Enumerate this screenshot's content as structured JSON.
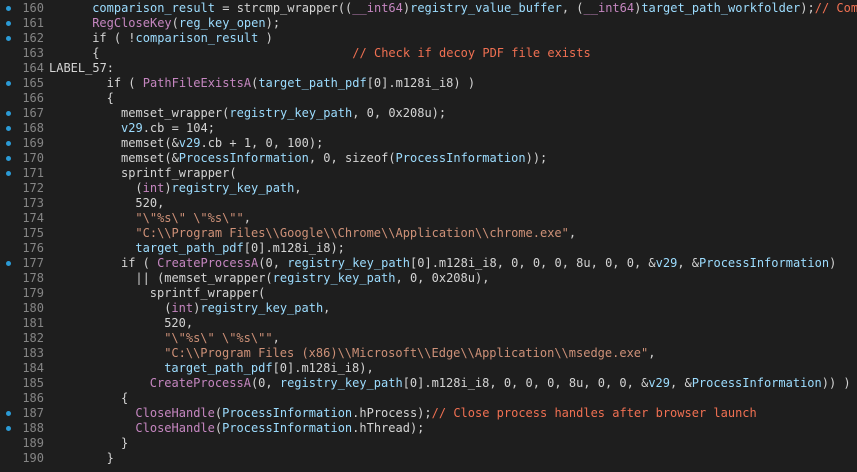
{
  "colors": {
    "background": "#1e1e1e",
    "line_number": "#858585",
    "breakpoint_dot": "#2b9bd6",
    "plain": "#d4d4d4",
    "variable": "#9cdcfe",
    "function": "#c586c0",
    "string": "#ce9178",
    "comment": "#f07052"
  },
  "lines": [
    {
      "num": "160",
      "dot": true,
      "indent": 6,
      "tokens": [
        {
          "t": "var",
          "s": "comparison_result"
        },
        {
          "t": "plain",
          "s": " = strcmp_wrapper(("
        },
        {
          "t": "type",
          "s": "__int64"
        },
        {
          "t": "plain",
          "s": ")"
        },
        {
          "t": "var",
          "s": "registry_value_buffer"
        },
        {
          "t": "plain",
          "s": ", ("
        },
        {
          "t": "type",
          "s": "__int64"
        },
        {
          "t": "plain",
          "s": ")"
        },
        {
          "t": "var",
          "s": "target_path_workfolder"
        },
        {
          "t": "plain",
          "s": ");"
        },
        {
          "t": "comment",
          "s": "// Compa"
        }
      ]
    },
    {
      "num": "161",
      "dot": true,
      "indent": 6,
      "tokens": [
        {
          "t": "fn",
          "s": "RegCloseKey"
        },
        {
          "t": "plain",
          "s": "("
        },
        {
          "t": "var",
          "s": "reg_key_open"
        },
        {
          "t": "plain",
          "s": ");"
        }
      ]
    },
    {
      "num": "162",
      "dot": true,
      "indent": 6,
      "tokens": [
        {
          "t": "plain",
          "s": "if ( !"
        },
        {
          "t": "var",
          "s": "comparison_result"
        },
        {
          "t": "plain",
          "s": " )"
        }
      ]
    },
    {
      "num": "163",
      "dot": false,
      "indent": 6,
      "tokens": [
        {
          "t": "plain",
          "s": "{"
        },
        {
          "t": "plain",
          "s": "                                   "
        },
        {
          "t": "comment",
          "s": "// Check if decoy PDF file exists"
        }
      ]
    },
    {
      "num": "164",
      "dot": false,
      "indent": 0,
      "tokens": [
        {
          "t": "plain",
          "s": "LABEL_57:"
        }
      ]
    },
    {
      "num": "165",
      "dot": true,
      "indent": 8,
      "tokens": [
        {
          "t": "plain",
          "s": "if ( "
        },
        {
          "t": "fn",
          "s": "PathFileExistsA"
        },
        {
          "t": "plain",
          "s": "("
        },
        {
          "t": "var",
          "s": "target_path_pdf"
        },
        {
          "t": "plain",
          "s": "[0].m128i_i8) )"
        }
      ]
    },
    {
      "num": "166",
      "dot": false,
      "indent": 8,
      "tokens": [
        {
          "t": "plain",
          "s": "{"
        }
      ]
    },
    {
      "num": "167",
      "dot": true,
      "indent": 10,
      "tokens": [
        {
          "t": "plain",
          "s": "memset_wrapper("
        },
        {
          "t": "var",
          "s": "registry_key_path"
        },
        {
          "t": "plain",
          "s": ", 0, 0x208u);"
        }
      ]
    },
    {
      "num": "168",
      "dot": true,
      "indent": 10,
      "tokens": [
        {
          "t": "var",
          "s": "v29"
        },
        {
          "t": "plain",
          "s": ".cb = 104;"
        }
      ]
    },
    {
      "num": "169",
      "dot": true,
      "indent": 10,
      "tokens": [
        {
          "t": "plain",
          "s": "memset(&"
        },
        {
          "t": "var",
          "s": "v29"
        },
        {
          "t": "plain",
          "s": ".cb + 1, 0, 100);"
        }
      ]
    },
    {
      "num": "170",
      "dot": true,
      "indent": 10,
      "tokens": [
        {
          "t": "plain",
          "s": "memset(&"
        },
        {
          "t": "var",
          "s": "ProcessInformation"
        },
        {
          "t": "plain",
          "s": ", 0, sizeof("
        },
        {
          "t": "var",
          "s": "ProcessInformation"
        },
        {
          "t": "plain",
          "s": "));"
        }
      ]
    },
    {
      "num": "171",
      "dot": true,
      "indent": 10,
      "tokens": [
        {
          "t": "plain",
          "s": "sprintf_wrapper("
        }
      ]
    },
    {
      "num": "172",
      "dot": false,
      "indent": 12,
      "tokens": [
        {
          "t": "plain",
          "s": "("
        },
        {
          "t": "type",
          "s": "int"
        },
        {
          "t": "plain",
          "s": ")"
        },
        {
          "t": "var",
          "s": "registry_key_path"
        },
        {
          "t": "plain",
          "s": ","
        }
      ]
    },
    {
      "num": "173",
      "dot": false,
      "indent": 12,
      "tokens": [
        {
          "t": "plain",
          "s": "520,"
        }
      ]
    },
    {
      "num": "174",
      "dot": false,
      "indent": 12,
      "tokens": [
        {
          "t": "str",
          "s": "\"\\\"%s\\\" \\\"%s\\\"\""
        },
        {
          "t": "plain",
          "s": ","
        }
      ]
    },
    {
      "num": "175",
      "dot": false,
      "indent": 12,
      "tokens": [
        {
          "t": "str",
          "s": "\"C:\\\\Program Files\\\\Google\\\\Chrome\\\\Application\\\\chrome.exe\""
        },
        {
          "t": "plain",
          "s": ","
        }
      ]
    },
    {
      "num": "176",
      "dot": false,
      "indent": 12,
      "tokens": [
        {
          "t": "var",
          "s": "target_path_pdf"
        },
        {
          "t": "plain",
          "s": "[0].m128i_i8);"
        }
      ]
    },
    {
      "num": "177",
      "dot": true,
      "indent": 10,
      "tokens": [
        {
          "t": "plain",
          "s": "if ( "
        },
        {
          "t": "fn",
          "s": "CreateProcessA"
        },
        {
          "t": "plain",
          "s": "(0, "
        },
        {
          "t": "var",
          "s": "registry_key_path"
        },
        {
          "t": "plain",
          "s": "[0].m128i_i8, 0, 0, 0, 8u, 0, 0, &"
        },
        {
          "t": "var",
          "s": "v29"
        },
        {
          "t": "plain",
          "s": ", &"
        },
        {
          "t": "var",
          "s": "ProcessInformation"
        },
        {
          "t": "plain",
          "s": ")"
        }
      ]
    },
    {
      "num": "178",
      "dot": false,
      "indent": 12,
      "tokens": [
        {
          "t": "plain",
          "s": "|| (memset_wrapper("
        },
        {
          "t": "var",
          "s": "registry_key_path"
        },
        {
          "t": "plain",
          "s": ", 0, 0x208u),"
        }
      ]
    },
    {
      "num": "179",
      "dot": false,
      "indent": 14,
      "tokens": [
        {
          "t": "plain",
          "s": "sprintf_wrapper("
        }
      ]
    },
    {
      "num": "180",
      "dot": false,
      "indent": 16,
      "tokens": [
        {
          "t": "plain",
          "s": "("
        },
        {
          "t": "type",
          "s": "int"
        },
        {
          "t": "plain",
          "s": ")"
        },
        {
          "t": "var",
          "s": "registry_key_path"
        },
        {
          "t": "plain",
          "s": ","
        }
      ]
    },
    {
      "num": "181",
      "dot": false,
      "indent": 16,
      "tokens": [
        {
          "t": "plain",
          "s": "520,"
        }
      ]
    },
    {
      "num": "182",
      "dot": false,
      "indent": 16,
      "tokens": [
        {
          "t": "str",
          "s": "\"\\\"%s\\\" \\\"%s\\\"\""
        },
        {
          "t": "plain",
          "s": ","
        }
      ]
    },
    {
      "num": "183",
      "dot": false,
      "indent": 16,
      "tokens": [
        {
          "t": "str",
          "s": "\"C:\\\\Program Files (x86)\\\\Microsoft\\\\Edge\\\\Application\\\\msedge.exe\""
        },
        {
          "t": "plain",
          "s": ","
        }
      ]
    },
    {
      "num": "184",
      "dot": false,
      "indent": 16,
      "tokens": [
        {
          "t": "var",
          "s": "target_path_pdf"
        },
        {
          "t": "plain",
          "s": "[0].m128i_i8),"
        }
      ]
    },
    {
      "num": "185",
      "dot": false,
      "indent": 14,
      "tokens": [
        {
          "t": "fn",
          "s": "CreateProcessA"
        },
        {
          "t": "plain",
          "s": "(0, "
        },
        {
          "t": "var",
          "s": "registry_key_path"
        },
        {
          "t": "plain",
          "s": "[0].m128i_i8, 0, 0, 0, 8u, 0, 0, &"
        },
        {
          "t": "var",
          "s": "v29"
        },
        {
          "t": "plain",
          "s": ", &"
        },
        {
          "t": "var",
          "s": "ProcessInformation"
        },
        {
          "t": "plain",
          "s": ")) )"
        }
      ]
    },
    {
      "num": "186",
      "dot": false,
      "indent": 10,
      "tokens": [
        {
          "t": "plain",
          "s": "{"
        }
      ]
    },
    {
      "num": "187",
      "dot": true,
      "indent": 12,
      "tokens": [
        {
          "t": "fn",
          "s": "CloseHandle"
        },
        {
          "t": "plain",
          "s": "("
        },
        {
          "t": "var",
          "s": "ProcessInformation"
        },
        {
          "t": "plain",
          "s": ".hProcess);"
        },
        {
          "t": "comment",
          "s": "// Close process handles after browser launch"
        }
      ]
    },
    {
      "num": "188",
      "dot": true,
      "indent": 12,
      "tokens": [
        {
          "t": "fn",
          "s": "CloseHandle"
        },
        {
          "t": "plain",
          "s": "("
        },
        {
          "t": "var",
          "s": "ProcessInformation"
        },
        {
          "t": "plain",
          "s": ".hThread);"
        }
      ]
    },
    {
      "num": "189",
      "dot": false,
      "indent": 10,
      "tokens": [
        {
          "t": "plain",
          "s": "}"
        }
      ]
    },
    {
      "num": "190",
      "dot": false,
      "indent": 8,
      "tokens": [
        {
          "t": "plain",
          "s": "}"
        }
      ]
    }
  ]
}
